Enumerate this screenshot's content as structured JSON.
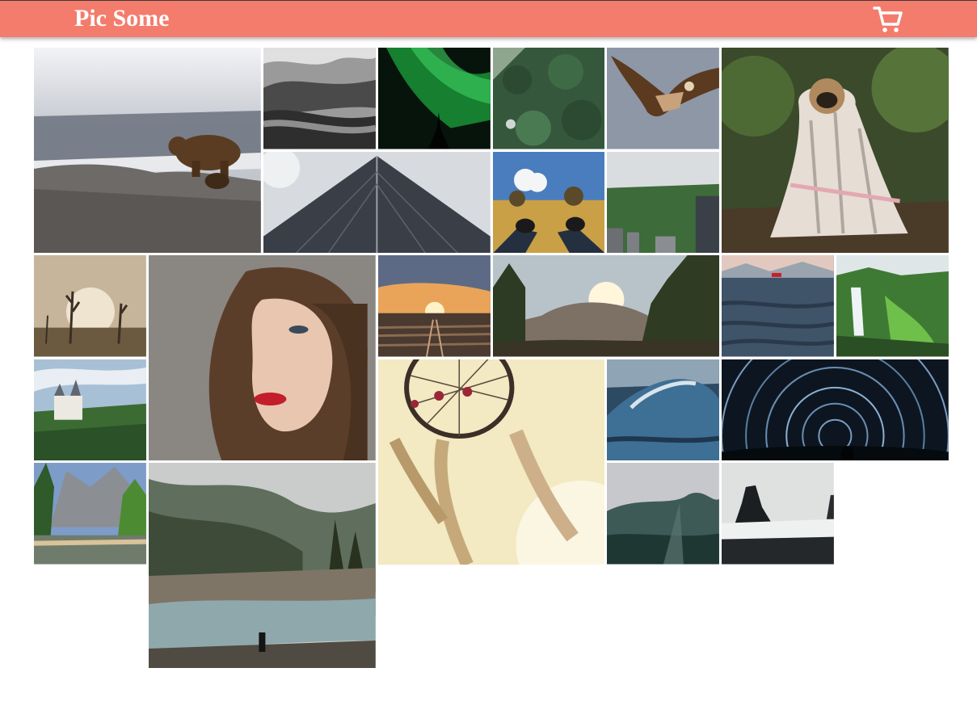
{
  "header": {
    "brand": "Pic Some",
    "background_color": "#f47c6c",
    "cart_icon": "shopping-cart-icon"
  },
  "gallery": {
    "photos": [
      {
        "subject": "brown-bear-on-rocks",
        "size": "big"
      },
      {
        "subject": "misty-forest-black-white",
        "size": "normal"
      },
      {
        "subject": "green-aurora-night",
        "size": "normal"
      },
      {
        "subject": "pine-forest-aerial",
        "size": "normal"
      },
      {
        "subject": "eagle-in-flight",
        "size": "normal"
      },
      {
        "subject": "pug-in-blanket",
        "size": "big"
      },
      {
        "subject": "skyscraper-looking-up",
        "size": "wide"
      },
      {
        "subject": "feet-in-field",
        "size": "normal"
      },
      {
        "subject": "city-park-aerial",
        "size": "normal"
      },
      {
        "subject": "dead-trees-foggy",
        "size": "normal"
      },
      {
        "subject": "woman-portrait",
        "size": "big"
      },
      {
        "subject": "railway-sunset",
        "size": "normal"
      },
      {
        "subject": "mountain-valley-sunset",
        "size": "wide"
      },
      {
        "subject": "lake-with-boat",
        "size": "normal"
      },
      {
        "subject": "waterfall-green",
        "size": "normal"
      },
      {
        "subject": "castle-hilltop",
        "size": "normal"
      },
      {
        "subject": "dreamcatcher",
        "size": "big"
      },
      {
        "subject": "ocean-wave",
        "size": "normal"
      },
      {
        "subject": "star-trails",
        "size": "wide"
      },
      {
        "subject": "yosemite-river",
        "size": "normal"
      },
      {
        "subject": "misty-river-hiker",
        "size": "big"
      },
      {
        "subject": "misty-mountain-forest",
        "size": "normal"
      },
      {
        "subject": "sea-stacks-beach",
        "size": "normal"
      }
    ]
  }
}
